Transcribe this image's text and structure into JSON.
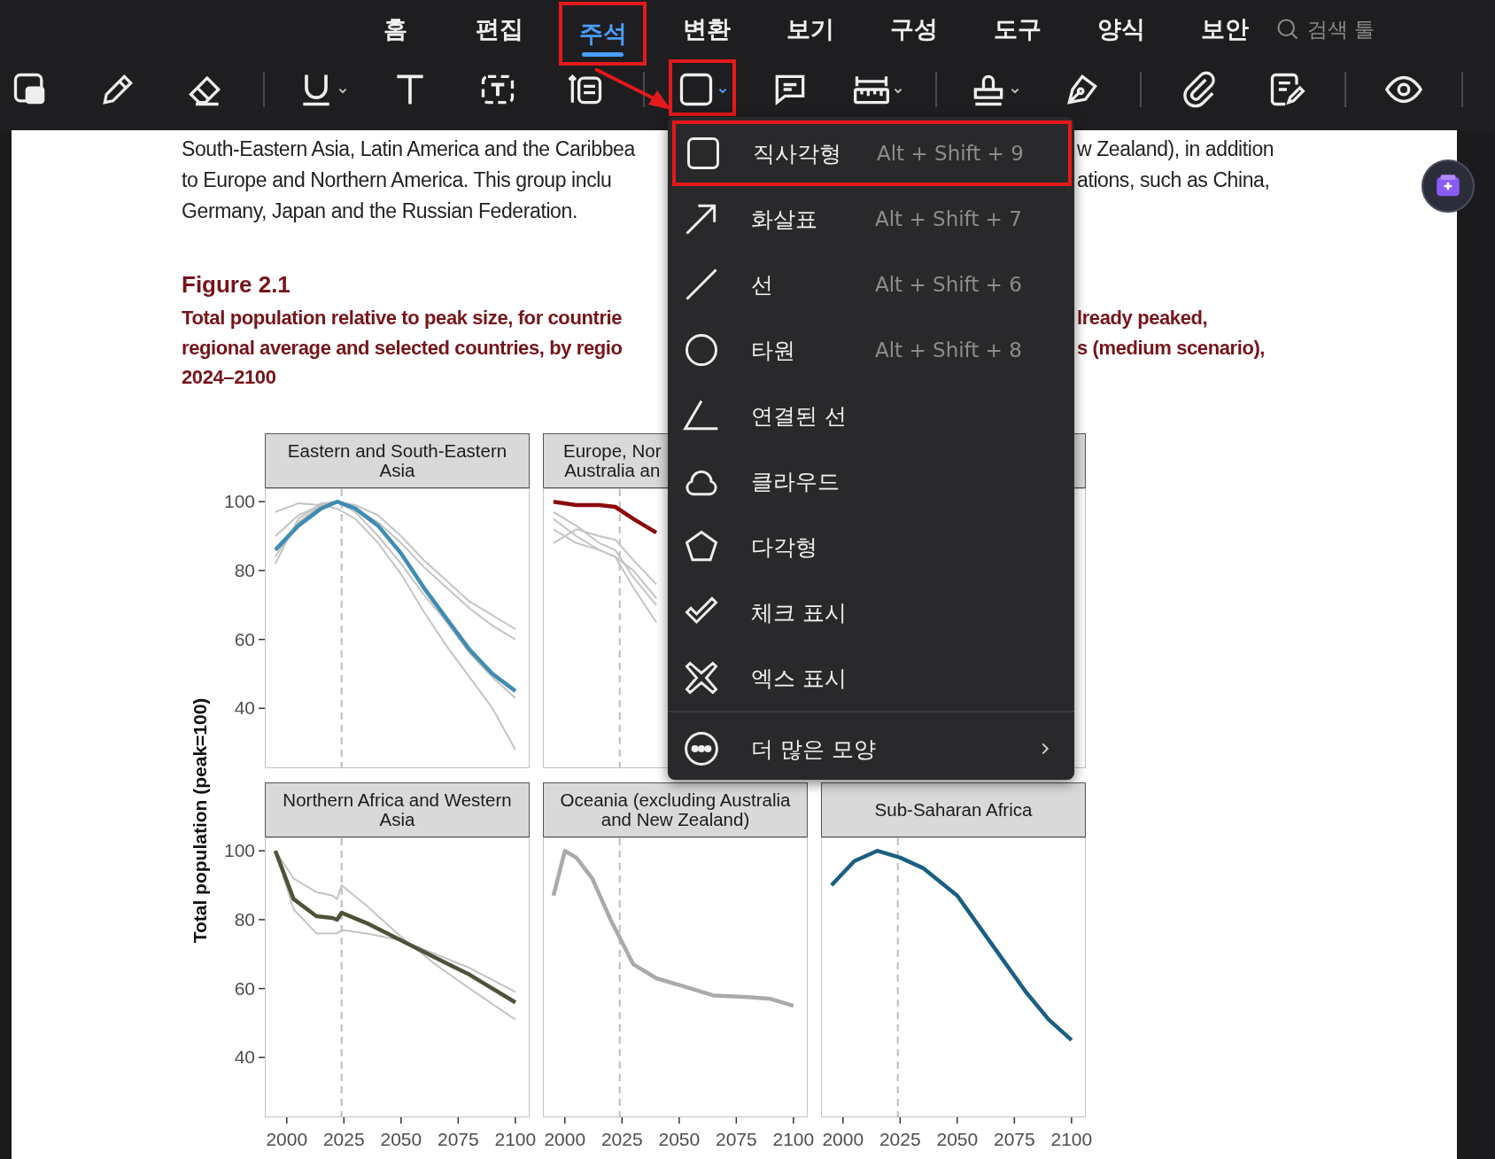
{
  "menu_tabs": [
    {
      "label": "홈",
      "selected": false,
      "outlined": false
    },
    {
      "label": "편집",
      "selected": false,
      "outlined": false
    },
    {
      "label": "주석",
      "selected": true,
      "outlined": true
    },
    {
      "label": "변환",
      "selected": false,
      "outlined": false
    },
    {
      "label": "보기",
      "selected": false,
      "outlined": false
    },
    {
      "label": "구성",
      "selected": false,
      "outlined": false
    },
    {
      "label": "도구",
      "selected": false,
      "outlined": false
    },
    {
      "label": "양식",
      "selected": false,
      "outlined": false
    },
    {
      "label": "보안",
      "selected": false,
      "outlined": false
    }
  ],
  "search": {
    "placeholder": "검색 툴"
  },
  "document": {
    "paragraph": [
      {
        "left": "South-Eastern Asia, Latin America and the Caribbea",
        "right": "w Zealand), in addition"
      },
      {
        "left": "to Europe and Northern America. This group inclu",
        "right": "ations, such as China,"
      },
      {
        "left": "Germany, Japan and the Russian Federation."
      }
    ],
    "figure_label": "Figure 2.1",
    "caption": [
      {
        "left": "Total population relative to peak size, for countrie",
        "right": "lready peaked,"
      },
      {
        "left": "regional average and selected countries, by regio",
        "right": "s (medium scenario),"
      },
      {
        "left": "2024–2100"
      }
    ],
    "figure": {
      "ylabel": "Total population (peak=100)",
      "panels": [
        {
          "kind": "chart",
          "chart_data": {
            "type": "line",
            "title": "Eastern and South-Eastern\nAsia",
            "x": [
              1995,
              2005,
              2015,
              2022,
              2030,
              2040,
              2050,
              2060,
              2070,
              2080,
              2090,
              2100
            ],
            "xlim": [
              1990.4,
              2106.25
            ],
            "ylim": [
              22.6,
              103.9
            ],
            "yticks": [
              40,
              60,
              80,
              100
            ],
            "ref_lines": [
              {
                "axis": "x",
                "value": 2024
              }
            ],
            "series": [
              {
                "color": "#c4c4c4",
                "values": [
                  82,
                  95,
                  99.5,
                  100,
                  99,
                  96,
                  90,
                  83,
                  77,
                  71,
                  67,
                  63
                ]
              },
              {
                "color": "#c4c4c4",
                "values": [
                  97,
                  99.5,
                  99,
                  98,
                  95,
                  88,
                  79,
                  68,
                  58,
                  49,
                  40,
                  28
                ]
              },
              {
                "color": "#c4c4c4",
                "values": [
                  90,
                  96,
                  99,
                  100,
                  97,
                  90,
                  82,
                  73,
                  65,
                  56,
                  49,
                  43
                ]
              },
              {
                "color": "#c4c4c4",
                "values": [
                  84,
                  94,
                  99,
                  100,
                  98,
                  94,
                  88,
                  81,
                  75,
                  69,
                  64,
                  60
                ]
              },
              {
                "color": "#3f8cb2",
                "values": [
                  86,
                  93,
                  98,
                  100,
                  98,
                  93,
                  85,
                  75,
                  66,
                  57,
                  50,
                  45
                ]
              }
            ]
          }
        },
        {
          "kind": "partly_covered",
          "chart_data": {
            "type": "line",
            "title": "Europe, Nor\nAustralia an",
            "x": [
              1995,
              2005,
              2015,
              2022,
              2030,
              2040
            ],
            "xlim": [
              1990.4,
              2106.25
            ],
            "ylim": [
              22.6,
              103.9
            ],
            "ref_lines": [
              {
                "axis": "x",
                "value": 2024
              }
            ],
            "series": [
              {
                "color": "#c4c4c4",
                "values": [
                  97,
                  93,
                  88,
                  86,
                  78,
                  70
                ]
              },
              {
                "color": "#c4c4c4",
                "values": [
                  95,
                  90,
                  86,
                  84,
                  75,
                  65
                ]
              },
              {
                "color": "#c4c4c4",
                "values": [
                  92,
                  88,
                  86,
                  84,
                  80,
                  72
                ]
              },
              {
                "color": "#c4c4c4",
                "values": [
                  88,
                  92,
                  90,
                  89,
                  83,
                  76
                ]
              },
              {
                "color": "#8b0a0a",
                "values": [
                  100,
                  99,
                  99,
                  98.5,
                  95,
                  91
                ]
              }
            ]
          }
        },
        {
          "kind": "covered"
        },
        {
          "kind": "chart",
          "chart_data": {
            "type": "line",
            "title": "Northern Africa and Western\nAsia",
            "x": [
              1995,
              2003,
              2013,
              2020,
              2022,
              2024,
              2035,
              2050,
              2065,
              2080,
              2100
            ],
            "xlim": [
              1990.4,
              2106.25
            ],
            "ylim": [
              22.6,
              103.9
            ],
            "yticks": [
              40,
              60,
              80,
              100
            ],
            "xticks": [
              2000,
              2025,
              2050,
              2075,
              2100
            ],
            "ref_lines": [
              {
                "axis": "x",
                "value": 2024
              }
            ],
            "series": [
              {
                "color": "#c4c4c4",
                "values": [
                  100,
                  92,
                  88,
                  87,
                  86,
                  90,
                  84,
                  75,
                  67,
                  60,
                  51
                ]
              },
              {
                "color": "#c4c4c4",
                "values": [
                  100,
                  83,
                  76,
                  76,
                  76,
                  77,
                  76,
                  74,
                  70,
                  66,
                  59
                ]
              },
              {
                "color": "#4d5238",
                "values": [
                  100,
                  86,
                  81,
                  80.5,
                  80,
                  82,
                  79,
                  74,
                  69,
                  64,
                  56
                ]
              }
            ]
          }
        },
        {
          "kind": "chart",
          "chart_data": {
            "type": "line",
            "title": "Oceania (excluding Australia\nand New Zealand)",
            "x": [
              1995,
              2000,
              2005,
              2012,
              2020,
              2030,
              2040,
              2050,
              2065,
              2080,
              2090,
              2100
            ],
            "xlim": [
              1990.4,
              2106.25
            ],
            "ylim": [
              22.6,
              103.9
            ],
            "xticks": [
              2000,
              2025,
              2050,
              2075,
              2100
            ],
            "ref_lines": [
              {
                "axis": "x",
                "value": 2024
              }
            ],
            "series": [
              {
                "color": "#aaaaaa",
                "values": [
                  87,
                  100,
                  98,
                  92,
                  80,
                  67,
                  63,
                  61,
                  58,
                  57.5,
                  57,
                  55
                ]
              }
            ]
          }
        },
        {
          "kind": "chart",
          "chart_data": {
            "type": "line",
            "title": "Sub-Saharan Africa",
            "x": [
              1995,
              2005,
              2015,
              2025,
              2035,
              2050,
              2065,
              2080,
              2090,
              2100
            ],
            "xlim": [
              1990.4,
              2106.25
            ],
            "ylim": [
              22.6,
              103.9
            ],
            "xticks": [
              2000,
              2025,
              2050,
              2075,
              2100
            ],
            "ref_lines": [
              {
                "axis": "x",
                "value": 2024
              }
            ],
            "series": [
              {
                "color": "#1b5f82",
                "values": [
                  90,
                  97,
                  100,
                  98,
                  95,
                  87,
                  73,
                  59,
                  51,
                  45
                ]
              }
            ]
          }
        }
      ]
    }
  },
  "shape_menu": {
    "items": [
      {
        "kind": "shape",
        "label": "직사각형",
        "shortcut": "Alt + Shift + 9",
        "outlined": true
      },
      {
        "kind": "shape",
        "label": "화살표",
        "shortcut": "Alt + Shift + 7",
        "outlined": false
      },
      {
        "kind": "shape",
        "label": "선",
        "shortcut": "Alt + Shift + 6",
        "outlined": false
      },
      {
        "kind": "shape",
        "label": "타원",
        "shortcut": "Alt + Shift + 8",
        "outlined": false
      },
      {
        "kind": "shape",
        "label": "연결된 선",
        "outlined": false
      },
      {
        "kind": "shape",
        "label": "클라우드",
        "outlined": false
      },
      {
        "kind": "shape",
        "label": "다각형",
        "outlined": false
      },
      {
        "kind": "shape",
        "label": "체크 표시",
        "outlined": false
      },
      {
        "kind": "shape",
        "label": "엑스 표시",
        "outlined": false
      },
      {
        "kind": "submenu",
        "label": "더 많은 모양",
        "outlined": false
      }
    ]
  }
}
